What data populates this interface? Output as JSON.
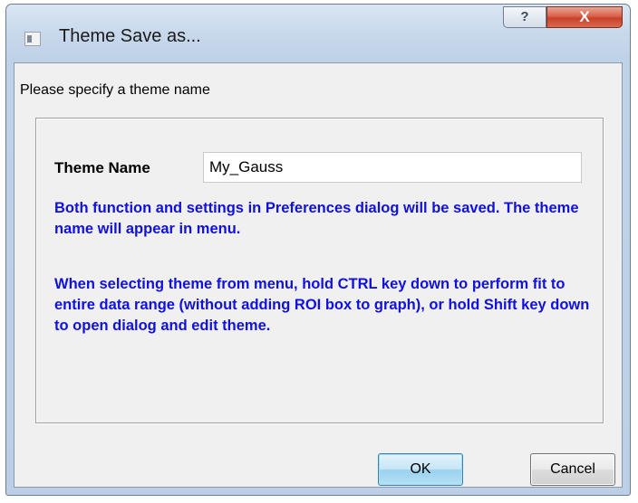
{
  "window": {
    "title": "Theme Save as...",
    "help_glyph": "?",
    "close_glyph": "X"
  },
  "dialog": {
    "prompt": "Please specify a theme name",
    "theme_name_label": "Theme Name",
    "theme_name_value": "My_Gauss",
    "info_line_1": "Both function and settings in Preferences dialog will be saved. The theme name will appear in menu.",
    "info_line_2": "When selecting theme from menu, hold CTRL key down to perform fit to entire data range (without adding ROI box to graph), or hold Shift key down to open dialog and edit theme."
  },
  "buttons": {
    "ok": "OK",
    "cancel": "Cancel"
  },
  "colors": {
    "info_text": "#1010e0",
    "close_button": "#c8412a"
  }
}
